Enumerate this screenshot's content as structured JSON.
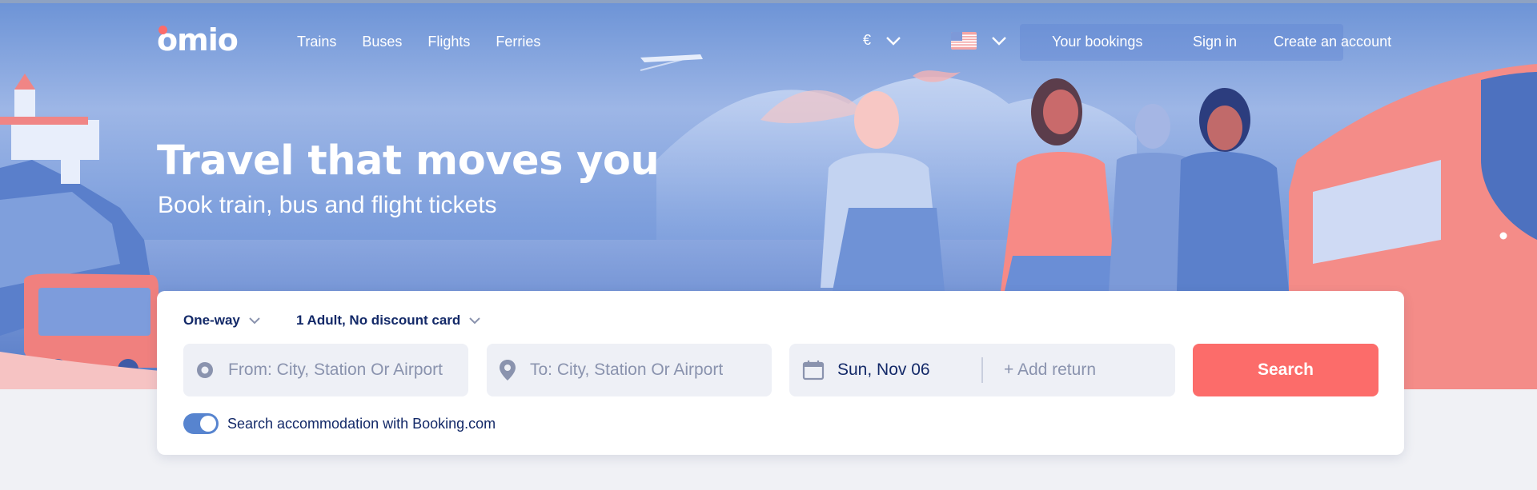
{
  "brand": {
    "logo_text": "omio",
    "accent_color": "#fc6c6a"
  },
  "nav": {
    "items": [
      "Trains",
      "Buses",
      "Flights",
      "Ferries"
    ]
  },
  "header_right": {
    "currency": "€",
    "language_flag": "us-flag-icon",
    "your_bookings": "Your bookings",
    "sign_in": "Sign in",
    "create_account": "Create an account"
  },
  "hero": {
    "headline": "Travel that moves you",
    "subheadline": "Book train, bus and flight tickets"
  },
  "search": {
    "trip_type": "One-way",
    "passengers": "1 Adult, No discount card",
    "from_placeholder": "From: City, Station Or Airport",
    "to_placeholder": "To: City, Station Or Airport",
    "date_value": "Sun, Nov 06",
    "return_placeholder": "+ Add return",
    "search_button": "Search",
    "accommodation_toggle_label": "Search accommodation with Booking.com",
    "accommodation_toggle_on": true
  },
  "colors": {
    "primary_text": "#132968",
    "button_red": "#fc6c6a",
    "toggle_blue": "#5784cf",
    "hero_blue": "#6c93d6"
  }
}
